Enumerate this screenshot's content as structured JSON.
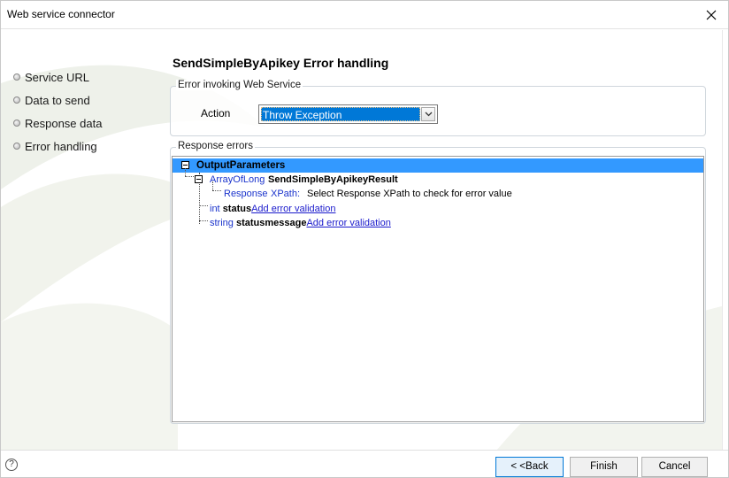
{
  "window": {
    "title": "Web service connector"
  },
  "steps": [
    {
      "label": "Service URL"
    },
    {
      "label": "Data to send"
    },
    {
      "label": "Response data"
    },
    {
      "label": "Error handling"
    }
  ],
  "main": {
    "heading": "SendSimpleByApikey Error handling",
    "invoke_group": {
      "legend": "Error invoking Web Service",
      "action_label": "Action",
      "action_value": "Throw Exception"
    },
    "errors_group": {
      "legend": "Response errors",
      "tree": {
        "root": "OutputParameters",
        "result_type": "ArrayOfLong",
        "result_name": "SendSimpleByApikeyResult",
        "response_label": "Response",
        "xpath_label": "XPath:",
        "xpath_hint": "Select Response XPath to check for error value",
        "status_type": "int",
        "status_name": "status",
        "status_link": "Add error validation",
        "message_type": "string",
        "message_name": "statusmessage",
        "message_link": "Add error validation"
      }
    }
  },
  "footer": {
    "help_glyph": "?",
    "back_label": "< <Back",
    "finish_label": "Finish",
    "cancel_label": "Cancel"
  },
  "icons": {
    "close": "close-icon",
    "help": "help-icon",
    "dropdown": "chevron-down-icon"
  }
}
